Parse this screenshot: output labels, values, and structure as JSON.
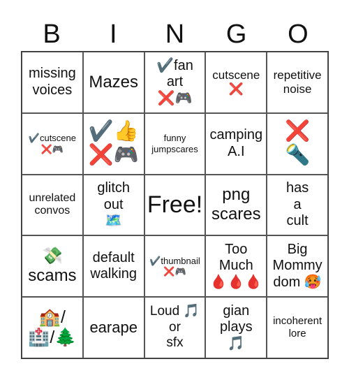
{
  "header": [
    "B",
    "I",
    "N",
    "G",
    "O"
  ],
  "cells": [
    "missing\nvoices",
    "Mazes",
    "✔️fan\nart\n❌🎮",
    "cutscene\n❌",
    "repetitive\nnoise",
    "✔️cutscene\n❌🎮",
    "✔️👍\n❌🎮",
    "funny\njumpscares",
    "camping\nA.I",
    "❌\n🔦",
    "unrelated\nconvos",
    "glitch\nout\n🗺️",
    "Free!",
    "png\nscares",
    "has\na\ncult",
    "💸\nscams",
    "default\nwalking",
    "✔️thumbnail\n❌🎮",
    "Too\nMuch\n🩸🩸🩸",
    "Big\nMommy\ndom 🥵",
    "🏫/\n🏥/🌲",
    "earape",
    "Loud 🎵\nor\nsfx",
    "gian\nplays\n🎵",
    "incoherent\nlore"
  ]
}
